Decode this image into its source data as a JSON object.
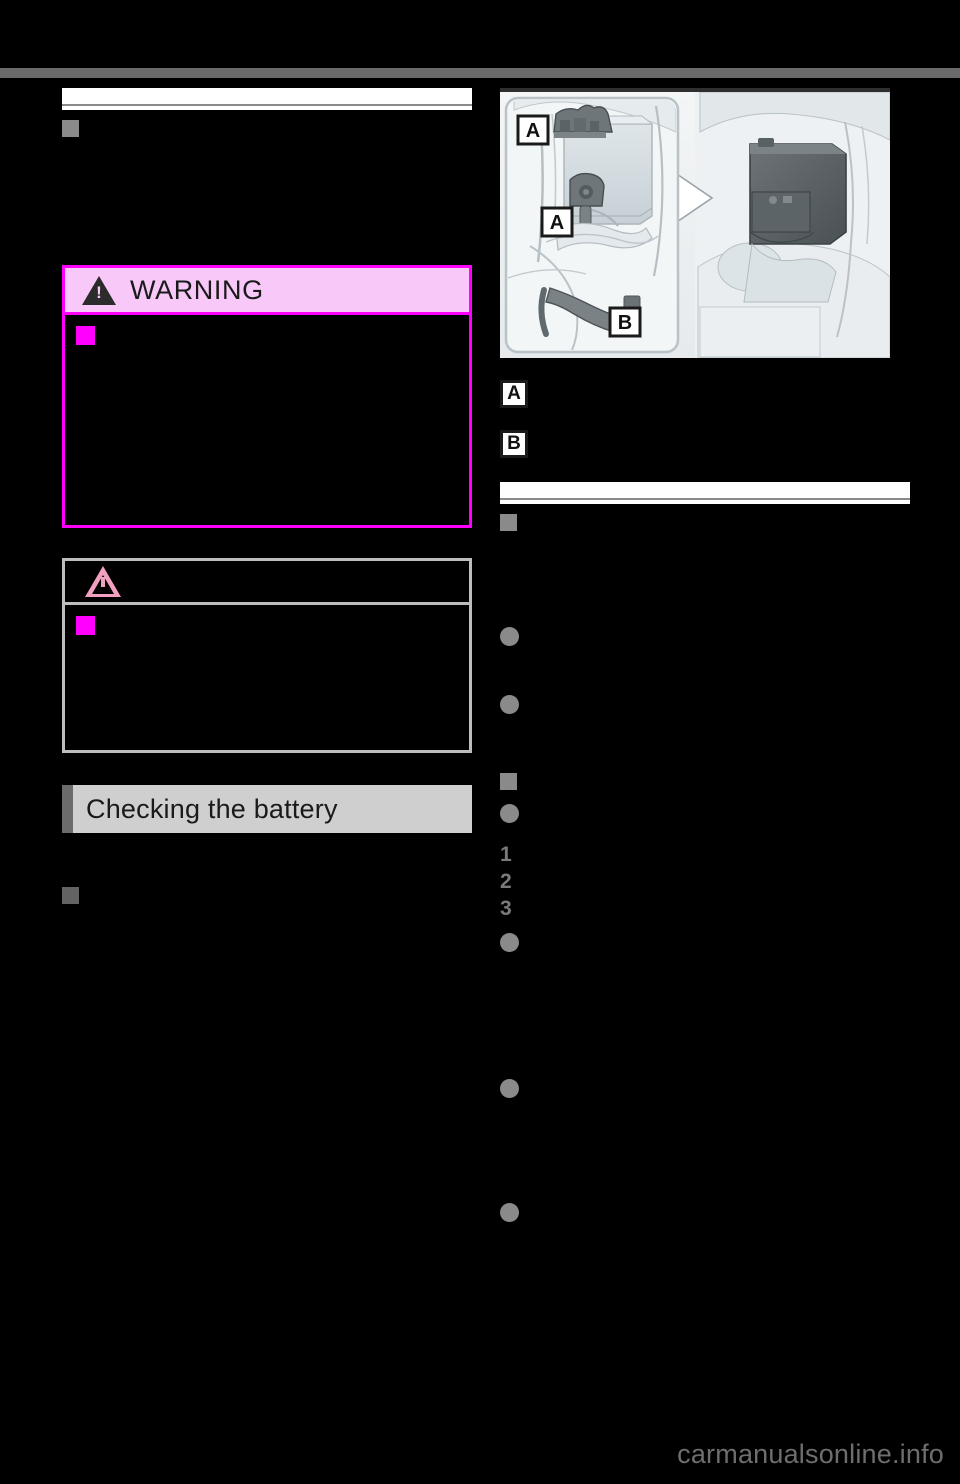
{
  "page": {
    "background": "#000000",
    "top_band_color": "#6b6b6b",
    "watermark": "carmanualsonline.info"
  },
  "left_column": {
    "subsection_1": {
      "marker": "square-bullet",
      "heading_text": "",
      "body_text": ""
    },
    "warning_box": {
      "title": "WARNING",
      "icon": "warning-triangle-icon",
      "header_bg": "#f8c8f8",
      "border_color": "#ff00ff",
      "bullet_color": "#ff00ff",
      "body_text": ""
    },
    "notice_box": {
      "title": "",
      "icon": "notice-triangle-icon",
      "border_color": "#bdbdbd",
      "icon_color": "#f2a0c0",
      "bullet_color": "#ff00ff",
      "body_text": ""
    },
    "section_header": {
      "label": "Checking the battery",
      "bar_color": "#6b6b6b",
      "plate_color": "#cfcfcf"
    },
    "subsection_2": {
      "marker": "square-bullet",
      "heading_text": "",
      "body_text": ""
    }
  },
  "right_column": {
    "figure": {
      "name": "engine-bay-battery-illustration",
      "callouts": [
        "A",
        "A",
        "B"
      ],
      "detail_view": "battery-fuse-box-closeup",
      "background": "#eceff0"
    },
    "legend": [
      {
        "key": "A",
        "text": ""
      },
      {
        "key": "B",
        "text": ""
      }
    ],
    "subsection_1": {
      "marker": "square-bullet",
      "heading_text": "",
      "body_text": ""
    },
    "bullets_group_1": [
      {
        "marker": "dot",
        "text": ""
      },
      {
        "marker": "dot",
        "text": ""
      }
    ],
    "subsection_2": {
      "marker": "square-bullet",
      "heading_text": ""
    },
    "bullets_group_2": [
      {
        "marker": "dot",
        "text": ""
      }
    ],
    "numbered_list": [
      {
        "number": "1",
        "text": ""
      },
      {
        "number": "2",
        "text": ""
      },
      {
        "number": "3",
        "text": ""
      }
    ],
    "bullets_group_3": [
      {
        "marker": "dot",
        "text": ""
      },
      {
        "marker": "dot",
        "text": ""
      },
      {
        "marker": "dot",
        "text": ""
      }
    ]
  }
}
